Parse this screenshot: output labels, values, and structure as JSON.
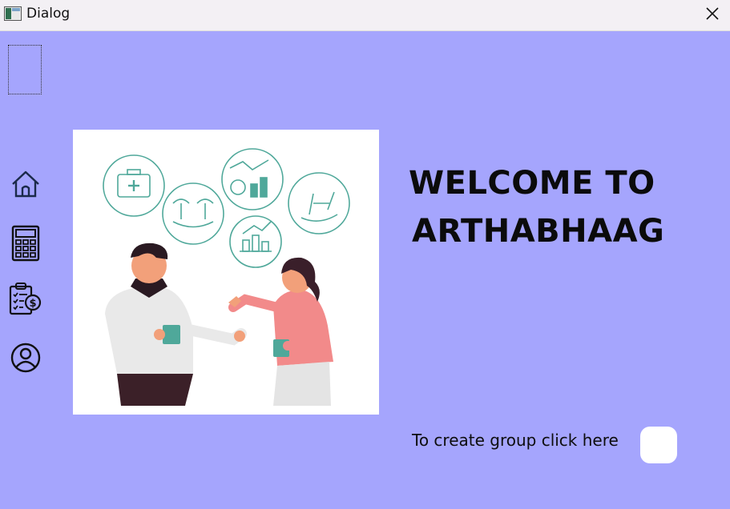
{
  "window": {
    "title": "Dialog"
  },
  "nav": {
    "items": [
      {
        "icon": "home-icon"
      },
      {
        "icon": "calculator-icon"
      },
      {
        "icon": "expense-clipboard-icon"
      },
      {
        "icon": "user-profile-icon"
      }
    ]
  },
  "main": {
    "welcome_line1": "WELCOME TO",
    "welcome_line2": "ARTHABHAAG",
    "cta_text": "To create group click here"
  },
  "colors": {
    "background": "#a5a5fd",
    "titlebar": "#f3f0f4",
    "panel": "#ffffff",
    "accent": "#4fa89a"
  }
}
